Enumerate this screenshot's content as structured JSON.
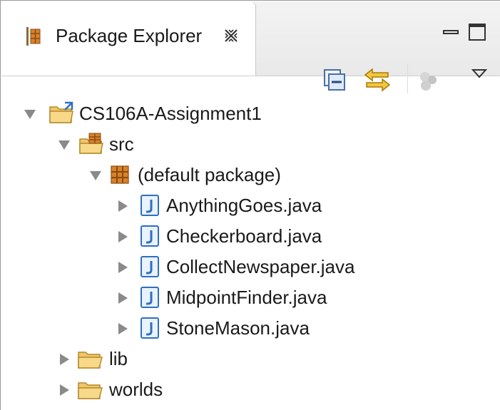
{
  "tab": {
    "title": "Package Explorer",
    "icon": "package-explorer-icon",
    "close_icon": "close-icon"
  },
  "window_controls": {
    "minimize": "minimize-icon",
    "maximize": "maximize-icon"
  },
  "toolbar": {
    "items": [
      "collapse-all-icon",
      "link-with-editor-icon",
      "filter-icon",
      "view-menu-icon"
    ]
  },
  "tree": {
    "project": {
      "label": "CS106A-Assignment1",
      "expanded": true,
      "icon": "project-folder-icon"
    },
    "src": {
      "label": "src",
      "expanded": true,
      "icon": "source-folder-icon"
    },
    "default_package": {
      "label": "(default package)",
      "expanded": true,
      "icon": "package-icon"
    },
    "files": [
      {
        "label": "AnythingGoes.java",
        "icon": "java-file-icon"
      },
      {
        "label": "Checkerboard.java",
        "icon": "java-file-icon"
      },
      {
        "label": "CollectNewspaper.java",
        "icon": "java-file-icon"
      },
      {
        "label": "MidpointFinder.java",
        "icon": "java-file-icon"
      },
      {
        "label": "StoneMason.java",
        "icon": "java-file-icon"
      }
    ],
    "folders": [
      {
        "label": "lib",
        "expanded": false,
        "icon": "folder-icon"
      },
      {
        "label": "worlds",
        "expanded": false,
        "icon": "folder-icon"
      }
    ]
  },
  "colors": {
    "twisty": "#8a8a8a",
    "package_icon": "#b5651d",
    "java_icon": "#2e6fc2",
    "folder": "#f5c26b"
  }
}
